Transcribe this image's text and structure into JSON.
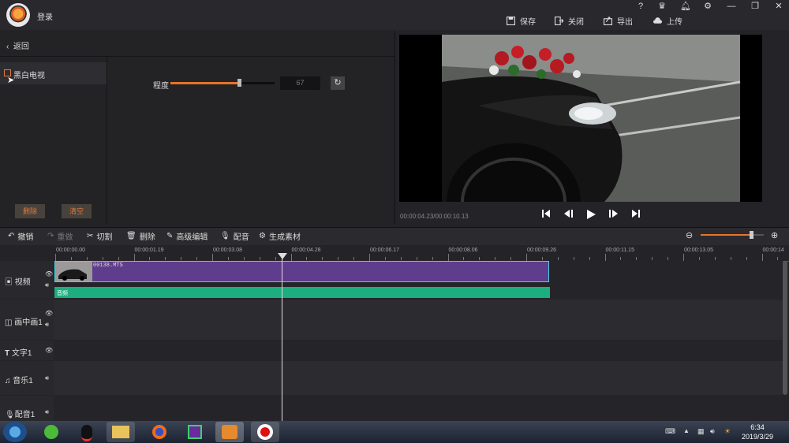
{
  "top": {
    "login": "登录",
    "save": "保存",
    "close": "关闭",
    "export": "导出",
    "upload": "上传",
    "win_help": "?",
    "win_min": "—",
    "win_close": "✕"
  },
  "left": {
    "back": "返回",
    "effect": "黑白电视",
    "degree_label": "程度",
    "degree_value": "67",
    "degree_fraction": 0.67,
    "delete": "删除",
    "clear": "清空"
  },
  "preview": {
    "timecode": "00:00:04.23/00:00:10.13"
  },
  "toolbar": {
    "undo": "撤销",
    "redo": "重做",
    "cut": "切割",
    "delete": "删除",
    "advanced": "高级编辑",
    "dub": "配音",
    "generate": "生成素材",
    "zoom_fraction": 0.8
  },
  "ruler": {
    "labels": [
      "00:00:00.00",
      "00:00:01.19",
      "00:00:03.08",
      "00:00:04.28",
      "00:00:06.17",
      "00:00:08.06",
      "00:00:09.26",
      "00:00:11.15",
      "00:00:13.05",
      "00:00:14"
    ]
  },
  "tracks": {
    "video": "视频",
    "pip": "画中画1",
    "text": "文字1",
    "music": "音乐1",
    "voice": "配音1",
    "clip_name": "00138.MTS",
    "audio_name": "音频"
  },
  "taskbar": {
    "time": "6:34",
    "date": "2019/3/29"
  },
  "colors": {
    "accent": "#e8732c",
    "clip": "#5e3d8d",
    "clip_border": "#4ad0e6",
    "audio": "#1cae7e"
  }
}
